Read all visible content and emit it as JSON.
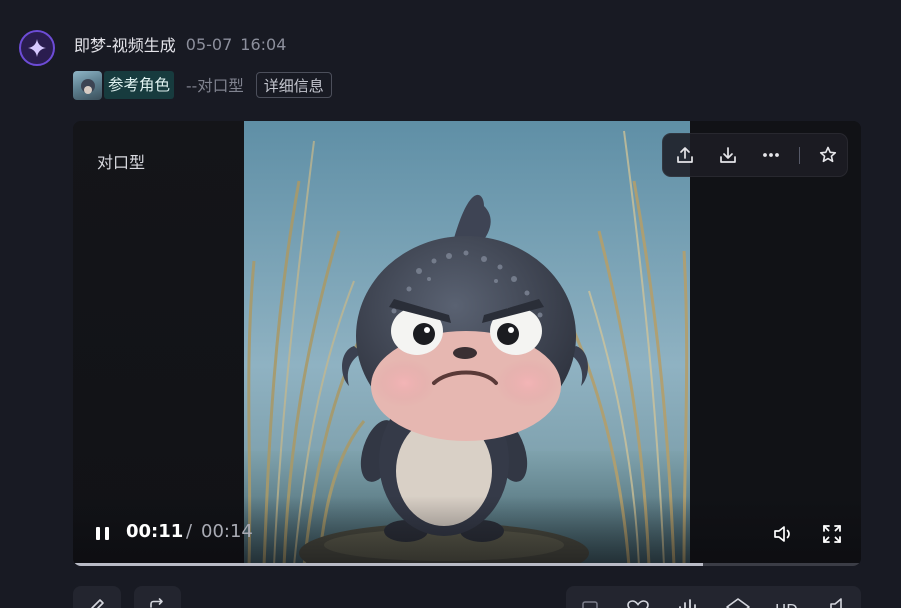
{
  "message": {
    "author": "即梦-视频生成",
    "date": "05-07",
    "time": "16:04",
    "reference_tag": "参考角色",
    "mode_text": "--对口型",
    "detail_button": "详细信息"
  },
  "video": {
    "overlay_label": "对口型",
    "current_time": "00:11",
    "separator": "/",
    "total_time": "00:14",
    "progress_fraction": 0.8
  },
  "toolbar_icons": [
    "share-icon",
    "download-icon",
    "more-icon",
    "star-icon"
  ],
  "action_icons_left": [
    "edit-icon",
    "reshare-icon"
  ],
  "action_icons_right": [
    "frame-icon",
    "heart-icon",
    "audio-wave-icon",
    "layers-icon",
    "hd-icon",
    "sound-icon"
  ],
  "action_labels": {
    "hd": "HD"
  },
  "colors": {
    "background": "#181a23",
    "accent": "#6d4cd6",
    "tag_bg": "#173b3e"
  }
}
